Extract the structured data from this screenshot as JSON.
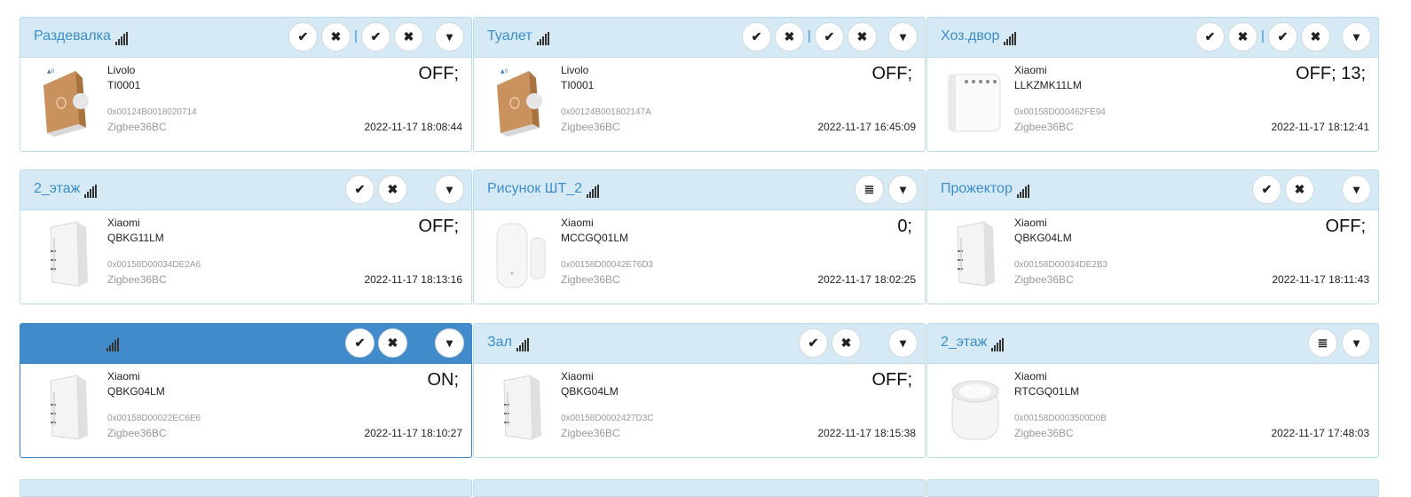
{
  "icons": {
    "confirm": "✔",
    "cancel": "✖",
    "dropdown": "▾",
    "list": "≣",
    "separator": "|"
  },
  "cards": [
    {
      "title": "Раздевалка",
      "vendor": "Livolo",
      "model": "TI0001",
      "ieee": "0x00124B0018020714",
      "network": "Zigbee36BC",
      "state": "OFF;",
      "timestamp": "2022-11-17 18:08:44",
      "image": "livolo-switch"
    },
    {
      "title": "Туалет",
      "vendor": "Livolo",
      "model": "TI0001",
      "ieee": "0x00124B001802147A",
      "network": "Zigbee36BC",
      "state": "OFF;",
      "timestamp": "2022-11-17 16:45:09",
      "image": "livolo-switch"
    },
    {
      "title": "Хоз.двор",
      "vendor": "Xiaomi",
      "model": "LLKZMK11LM",
      "ieee": "0x00158D000462FE94",
      "network": "Zigbee36BC",
      "state": "OFF; 13;",
      "timestamp": "2022-11-17 18:12:41",
      "image": "relay-module"
    },
    {
      "title": "2_этаж",
      "vendor": "Xiaomi",
      "model": "QBKG11LM",
      "ieee": "0x00158D00034DE2A6",
      "network": "Zigbee36BC",
      "state": "OFF;",
      "timestamp": "2022-11-17 18:13:16",
      "image": "aqara-switch"
    },
    {
      "title": "Рисунок ШТ_2",
      "vendor": "Xiaomi",
      "model": "MCCGQ01LM",
      "ieee": "0x00158D00042E76D3",
      "network": "Zigbee36BC",
      "state": "0;",
      "timestamp": "2022-11-17 18:02:25",
      "image": "door-sensor"
    },
    {
      "title": "Прожектор",
      "vendor": "Xiaomi",
      "model": "QBKG04LM",
      "ieee": "0x00158D00034DE2B3",
      "network": "Zigbee36BC",
      "state": "OFF;",
      "timestamp": "2022-11-17 18:11:43",
      "image": "aqara-switch"
    },
    {
      "title": "",
      "vendor": "Xiaomi",
      "model": "QBKG04LM",
      "ieee": "0x00158D00022EC6E6",
      "network": "Zigbee36BC",
      "state": "ON;",
      "timestamp": "2022-11-17 18:10:27",
      "image": "aqara-switch"
    },
    {
      "title": "Зал",
      "vendor": "Xiaomi",
      "model": "QBKG04LM",
      "ieee": "0x00158D0002427D3C",
      "network": "Zigbee36BC",
      "state": "OFF;",
      "timestamp": "2022-11-17 18:15:38",
      "image": "aqara-switch"
    },
    {
      "title": "2_этаж",
      "vendor": "Xiaomi",
      "model": "RTCGQ01LM",
      "ieee": "0x00158D0003500D0B",
      "network": "Zigbee36BC",
      "state": "",
      "timestamp": "2022-11-17 17:48:03",
      "image": "motion-sensor"
    }
  ]
}
